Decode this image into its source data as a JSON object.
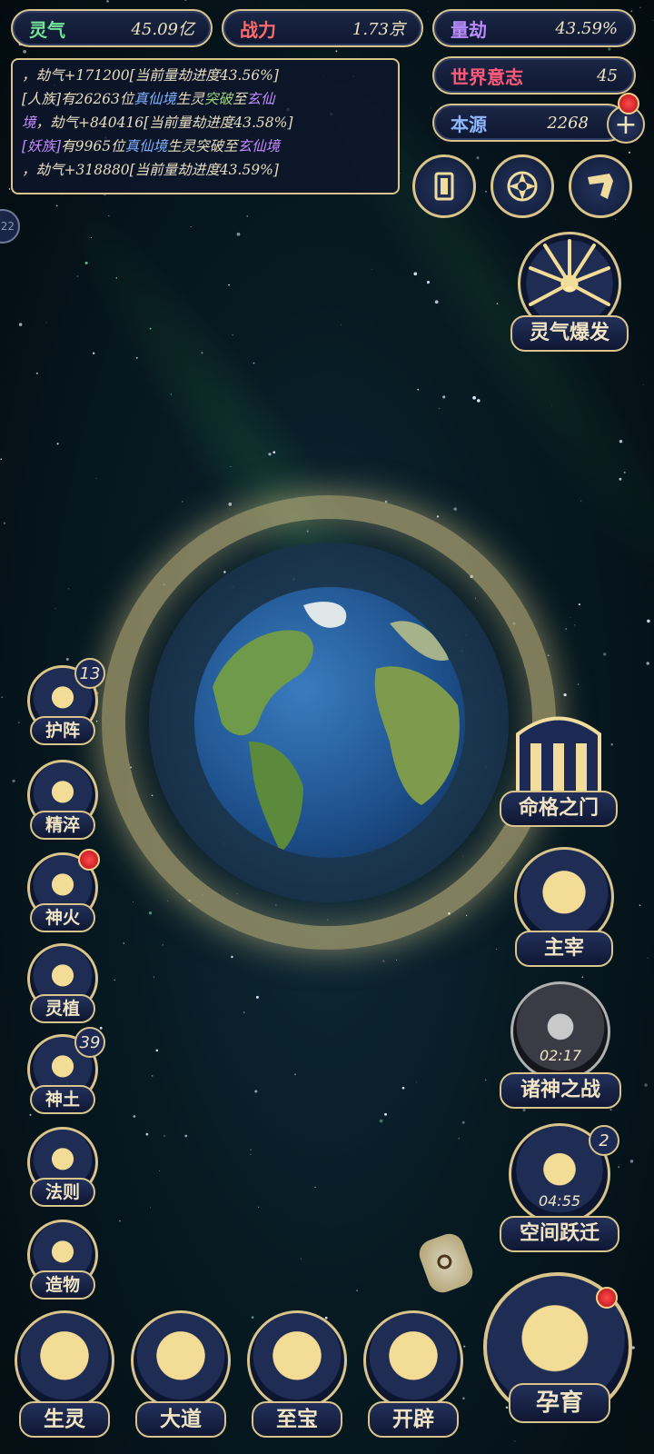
{
  "stats": {
    "lingqi": {
      "label": "灵气",
      "value": "45.09亿",
      "color": "#74e39a"
    },
    "zhanli": {
      "label": "战力",
      "value": "1.73京",
      "color": "#ff6b6b"
    },
    "liangjie": {
      "label": "量劫",
      "value": "43.59%",
      "color": "#b98cff"
    },
    "shijie": {
      "label": "世界意志",
      "value": "45",
      "color": "#ff5a7a"
    },
    "benyuan": {
      "label": "本源",
      "value": "2268",
      "color": "#8fb7ff"
    }
  },
  "log": {
    "line1": "，劫气+171200[当前量劫进度43.56%]",
    "line2a": "[人族]有26263位",
    "line2b": "真仙境",
    "line2c": "生灵",
    "line2d": "突破",
    "line2e": "至",
    "line2f": "玄仙",
    "line3a": "境",
    "line3b": "，劫气+840416[当前量劫进度43.58%]",
    "line4a": "[妖族]",
    "line4b": "有9965位",
    "line4c": "真仙境",
    "line4d": "生灵突破至",
    "line4e": "玄仙境",
    "line5": "，劫气+318880[当前量劫进度43.59%]"
  },
  "top_icons": [
    "card-icon",
    "vortex-icon",
    "scroll-icon"
  ],
  "left_buttons": [
    {
      "label": "护阵",
      "badge": "13"
    },
    {
      "label": "精淬"
    },
    {
      "label": "神火",
      "alert": true
    },
    {
      "label": "灵植"
    },
    {
      "label": "神土",
      "badge": "39"
    },
    {
      "label": "法则"
    },
    {
      "label": "造物"
    }
  ],
  "right_buttons": {
    "burst": "灵气爆发",
    "destiny": "命格之门",
    "master": "主宰",
    "war": {
      "label": "诸神之战",
      "timer": "02:17"
    },
    "jump": {
      "label": "空间跃迁",
      "timer": "04:55",
      "badge": "2"
    }
  },
  "bottom_buttons": [
    "生灵",
    "大道",
    "至宝",
    "开辟"
  ],
  "main_button": "孕育",
  "side_tab": "22"
}
